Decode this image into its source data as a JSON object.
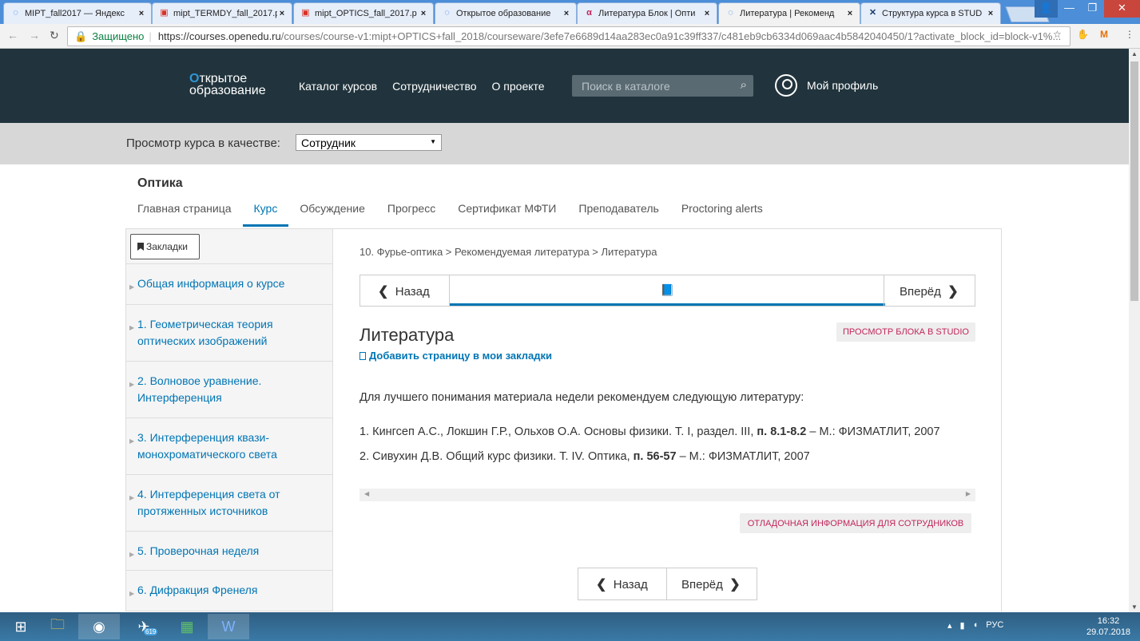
{
  "browser": {
    "tabs": [
      {
        "label": "MIPT_fall2017 — Яндекс",
        "icon": "loading-icon",
        "active": false
      },
      {
        "label": "mipt_TERMDY_fall_2017.p",
        "icon": "pdf-icon",
        "active": false
      },
      {
        "label": "mipt_OPTICS_fall_2017.p",
        "icon": "pdf-icon",
        "active": false
      },
      {
        "label": "Открытое образование",
        "icon": "loading-icon",
        "active": false
      },
      {
        "label": "Литература Блок | Опти",
        "icon": "studio-icon",
        "active": false
      },
      {
        "label": "Литература | Рекоменд",
        "icon": "loading-icon",
        "active": true
      },
      {
        "label": "Структура курса в STUD",
        "icon": "studio-x-icon",
        "active": false
      }
    ],
    "secure_label": "Защищено",
    "url_host": "https://courses.openedu.ru",
    "url_path": "/courses/course-v1:mipt+OPTICS+fall_2018/courseware/3efe7e6689d14aa283ec0a91c39ff337/c481eb9cb6334d069aac4b5842040450/1?activate_block_id=block-v1%..."
  },
  "site": {
    "logo_line1": "ткрытое",
    "logo_line2": "образование",
    "nav": [
      "Каталог курсов",
      "Сотрудничество",
      "О проекте"
    ],
    "search_placeholder": "Поиск в каталоге",
    "profile_label": "Мой профиль"
  },
  "preview": {
    "label": "Просмотр курса в качестве:",
    "selected": "Сотрудник"
  },
  "course": {
    "title": "Оптика",
    "tabs": [
      "Главная страница",
      "Курс",
      "Обсуждение",
      "Прогресс",
      "Сертификат МФТИ",
      "Преподаватель",
      "Proctoring alerts"
    ],
    "active_tab": "Курс"
  },
  "sidebar": {
    "bookmarks_label": "Закладки",
    "chapters": [
      "Общая информация о курсе",
      "1. Геометрическая теория оптических изображений",
      "2. Волновое уравнение. Интерференция",
      "3. Интерференция квази-монохроматического света",
      "4. Интерференция света от протяженных источников",
      "5. Проверочная неделя",
      "6. Дифракция Френеля"
    ]
  },
  "main": {
    "breadcrumb": "10. Фурье-оптика > Рекомендуемая литература > Литература",
    "prev_label": "Назад",
    "next_label": "Вперёд",
    "unit_title": "Литература",
    "studio_button": "ПРОСМОТР БЛОКА В STUDIO",
    "add_bookmark": "Добавить страницу в мои закладки",
    "intro": "Для лучшего понимания материала недели рекомендуем следующую литературу:",
    "lit1_pre": "1. Кингсеп А.С., Локшин Г.Р., Ольхов О.А. Основы физики. Т. I, раздел. III, ",
    "lit1_bold": "п. 8.1-8.2",
    "lit1_post": " – М.: ФИЗМАТЛИТ, 2007",
    "lit2_pre": "2. Сивухин Д.В. Общий курс физики. Т. IV. Оптика, ",
    "lit2_bold": "п. 56-57",
    "lit2_post": "  – М.: ФИЗМАТЛИТ, 2007",
    "debug_button": "ОТЛАДОЧНАЯ ИНФОРМАЦИЯ ДЛЯ СОТРУДНИКОВ"
  },
  "taskbar": {
    "telegram_badge": "619",
    "lang": "РУС",
    "time": "16:32",
    "date": "29.07.2018"
  }
}
